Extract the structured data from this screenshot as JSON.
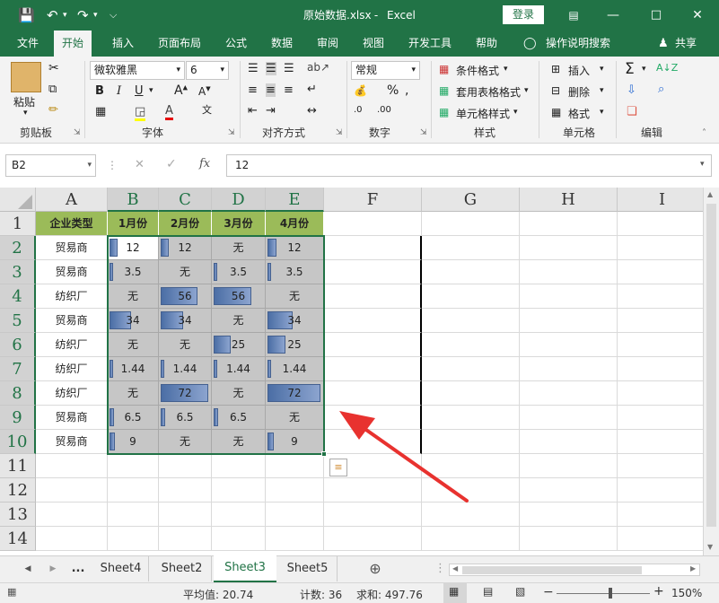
{
  "title": {
    "filename": "原始数据.xlsx",
    "sep": " - ",
    "app": "Excel",
    "login": "登录"
  },
  "tabs": [
    "文件",
    "开始",
    "插入",
    "页面布局",
    "公式",
    "数据",
    "审阅",
    "视图",
    "开发工具",
    "帮助"
  ],
  "tellme": "操作说明搜索",
  "share": "共享",
  "ribbon": {
    "clipboard": {
      "paste": "粘贴",
      "label": "剪贴板"
    },
    "font": {
      "name": "微软雅黑",
      "size": "6",
      "label": "字体"
    },
    "align": {
      "label": "对齐方式"
    },
    "number": {
      "format": "常规",
      "label": "数字"
    },
    "styles": {
      "cond": "条件格式",
      "table": "套用表格格式",
      "cell": "单元格样式",
      "label": "样式"
    },
    "cells": {
      "insert": "插入",
      "delete": "删除",
      "format": "格式",
      "label": "单元格"
    },
    "editing": {
      "label": "编辑"
    }
  },
  "formula_bar": {
    "namebox": "B2",
    "fx": "fx",
    "value": "12"
  },
  "columns": [
    "A",
    "B",
    "C",
    "D",
    "E",
    "F",
    "G",
    "H",
    "I"
  ],
  "rows": [
    "1",
    "2",
    "3",
    "4",
    "5",
    "6",
    "7",
    "8",
    "9",
    "10",
    "11",
    "12",
    "13",
    "14"
  ],
  "header_row": [
    "企业类型",
    "1月份",
    "2月份",
    "3月份",
    "4月份"
  ],
  "data": [
    [
      "贸易商",
      "12",
      "12",
      "无",
      "12"
    ],
    [
      "贸易商",
      "3.5",
      "无",
      "3.5",
      "3.5"
    ],
    [
      "纺织厂",
      "无",
      "56",
      "56",
      "无"
    ],
    [
      "贸易商",
      "34",
      "34",
      "无",
      "34"
    ],
    [
      "纺织厂",
      "无",
      "无",
      "25",
      "25"
    ],
    [
      "纺织厂",
      "1.44",
      "1.44",
      "1.44",
      "1.44"
    ],
    [
      "纺织厂",
      "无",
      "72",
      "无",
      "72"
    ],
    [
      "贸易商",
      "6.5",
      "6.5",
      "6.5",
      "无"
    ],
    [
      "贸易商",
      "9",
      "无",
      "无",
      "9"
    ]
  ],
  "sheets": [
    "...",
    "Sheet4",
    "Sheet2",
    "Sheet3",
    "Sheet5"
  ],
  "active_sheet": "Sheet3",
  "status": {
    "average": "平均值: 20.74",
    "count": "计数: 36",
    "sum": "求和: 497.76",
    "zoom": "150%"
  },
  "colors": {
    "accent": "#217346",
    "header_fill": "#9bbb59",
    "selection": "#c6c6c6",
    "bar": "#5a7bb0"
  }
}
